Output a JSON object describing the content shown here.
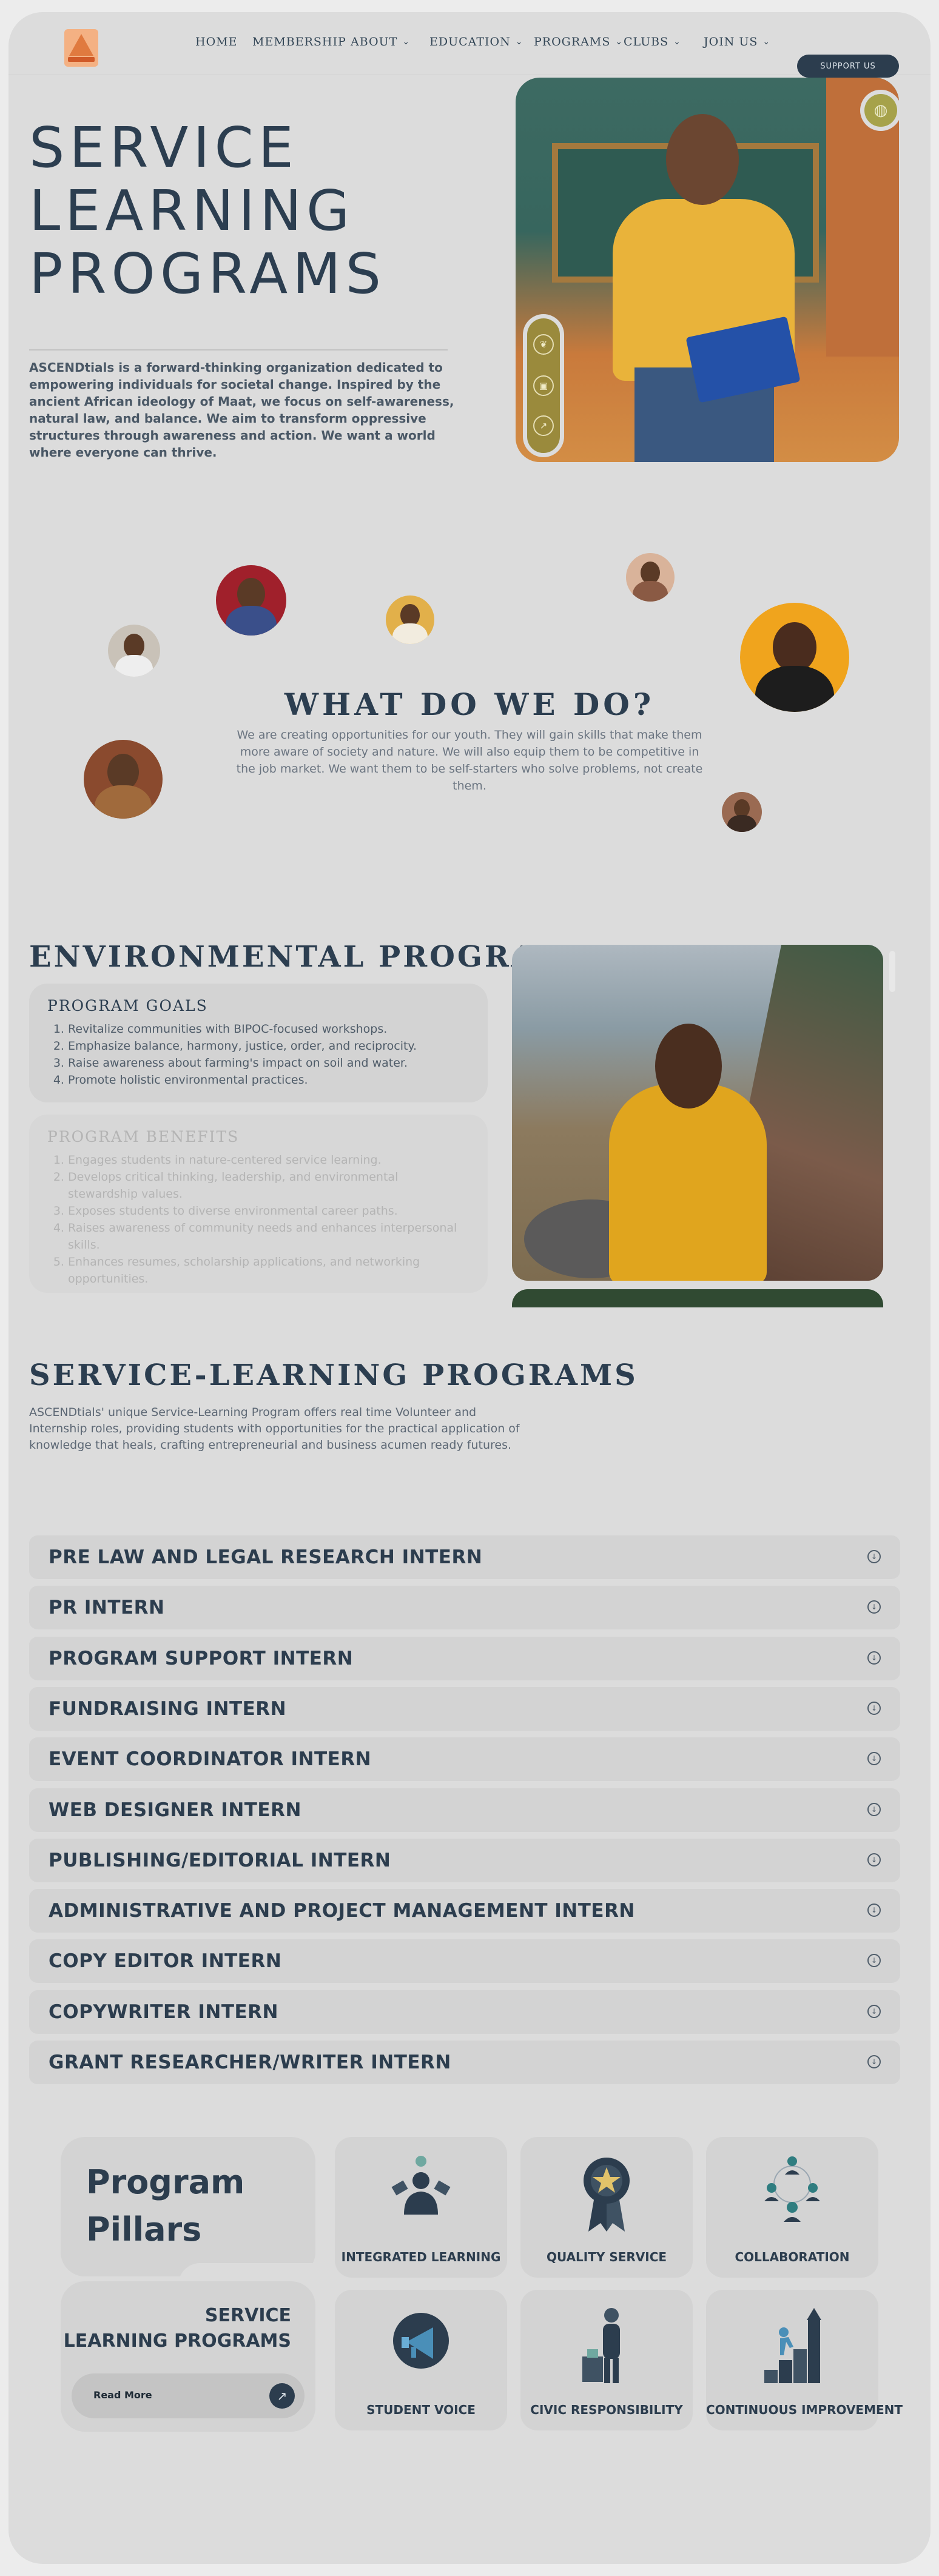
{
  "nav": {
    "logo_alt": "ASCENDtials logo",
    "items": [
      {
        "label": "HOME",
        "dropdown": false
      },
      {
        "label": "MEMBERSHIP",
        "dropdown": false
      },
      {
        "label": "ABOUT",
        "dropdown": true
      },
      {
        "label": "EDUCATION",
        "dropdown": true
      },
      {
        "label": "PROGRAMS",
        "dropdown": true
      },
      {
        "label": "CLUBS",
        "dropdown": true
      },
      {
        "label": "JOIN US",
        "dropdown": true
      }
    ],
    "support_label": "SUPPORT US"
  },
  "hero": {
    "title_line1": "SERVICE",
    "title_line2": "LEARNING",
    "title_line3": "PROGRAMS",
    "description": "ASCENDtials is a forward-thinking organization dedicated to empowering individuals for societal change. Inspired by the ancient African ideology of Maat, we focus on self-awareness, natural law, and balance. We aim to transform oppressive structures through awareness and action. We want a world where everyone can thrive."
  },
  "what_we_do": {
    "title": "WHAT DO WE DO?",
    "text": "We are creating opportunities for our youth. They will gain skills that make them more aware of society and nature. We will also equip them to be competitive in the job market. We want them to be self-starters who solve problems, not create them."
  },
  "environmental": {
    "title": "ENVIRONMENTAL PROGRAMS",
    "goals_title": "PROGRAM GOALS",
    "goals": [
      "Revitalize communities with BIPOC-focused workshops.",
      "Emphasize balance, harmony, justice, order, and reciprocity.",
      "Raise awareness about farming's impact on soil and water.",
      "Promote holistic environmental practices."
    ],
    "benefits_title": "PROGRAM BENEFITS",
    "benefits": [
      "Engages students in nature-centered service learning.",
      "Develops critical thinking, leadership, and environmental stewardship values.",
      "Exposes students to diverse environmental career paths.",
      "Raises awareness of community needs and enhances interpersonal skills.",
      "Enhances resumes, scholarship applications, and networking opportunities."
    ]
  },
  "service_learning": {
    "title": "SERVICE-LEARNING PROGRAMS",
    "description": "ASCENDtials' unique Service-Learning Program offers real time Volunteer and Internship roles, providing students with opportunities for the practical application of knowledge that heals, crafting entrepreneurial and business acumen ready futures.",
    "internships": [
      "PRE LAW AND LEGAL RESEARCH INTERN",
      "PR INTERN",
      "PROGRAM SUPPORT INTERN",
      "FUNDRAISING INTERN",
      "EVENT COORDINATOR INTERN",
      "WEB DESIGNER INTERN",
      "PUBLISHING/EDITORIAL INTERN",
      "ADMINISTRATIVE AND PROJECT MANAGEMENT INTERN",
      "COPY EDITOR INTERN",
      "COPYWRITER INTERN",
      "GRANT RESEARCHER/WRITER INTERN"
    ]
  },
  "pillars": {
    "title_line1": "Program",
    "title_line2": "Pillars",
    "sl_line1": "SERVICE",
    "sl_line2": "LEARNING PROGRAMS",
    "read_more": "Read More",
    "items": [
      "INTEGRATED LEARNING",
      "QUALITY SERVICE",
      "COLLABORATION",
      "STUDENT VOICE",
      "CIVIC RESPONSIBILITY",
      "CONTINUOUS IMPROVEMENT"
    ]
  },
  "colors": {
    "page_bg": "#dcdcdc",
    "navy": "#2c3d4e",
    "card_bg": "#d3d3d3",
    "accent_gold": "#e9b33a"
  }
}
